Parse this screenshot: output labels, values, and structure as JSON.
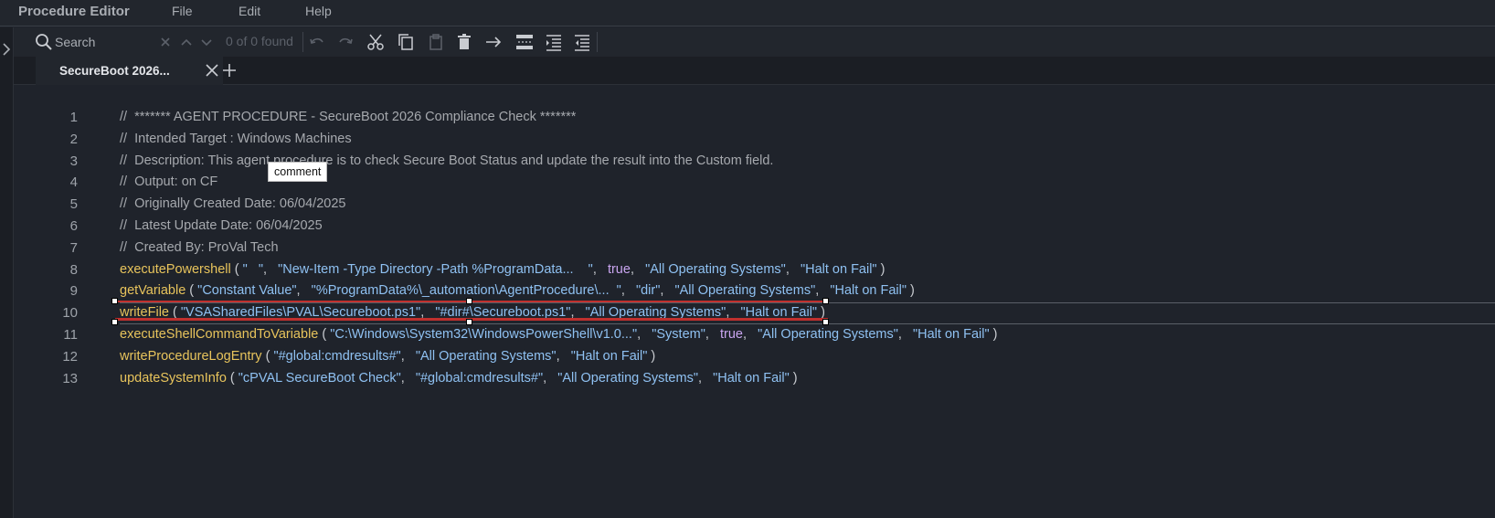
{
  "app": {
    "title": "Procedure Editor"
  },
  "menu": {
    "file": "File",
    "edit": "Edit",
    "help": "Help"
  },
  "toolbar": {
    "search_placeholder": "Search",
    "found_count": "0 of 0 found"
  },
  "tabs": [
    {
      "label": "SecureBoot 2026..."
    }
  ],
  "tooltip": "comment",
  "lines": [
    {
      "num": "1",
      "comment": "//  ******* AGENT PROCEDURE - SecureBoot 2026 Compliance Check *******"
    },
    {
      "num": "2",
      "comment": "//  Intended Target : Windows Machines"
    },
    {
      "num": "3",
      "comment": "//  Description: This agent procedure is to check Secure Boot Status and update the result into the Custom field."
    },
    {
      "num": "4",
      "comment": "//  Output: on CF"
    },
    {
      "num": "5",
      "comment": "//  Originally Created Date: 06/04/2025"
    },
    {
      "num": "6",
      "comment": "//  Latest Update Date: 06/04/2025"
    },
    {
      "num": "7",
      "comment": "//  Created By: ProVal Tech"
    },
    {
      "num": "8",
      "fn": "executePowershell",
      "args": [
        {
          "t": "str",
          "v": "\"   \""
        },
        {
          "t": "str",
          "v": "\"New-Item -Type Directory -Path %ProgramData...    \""
        },
        {
          "t": "bool",
          "v": "true"
        },
        {
          "t": "str",
          "v": "\"All Operating Systems\""
        },
        {
          "t": "str",
          "v": "\"Halt on Fail\""
        }
      ]
    },
    {
      "num": "9",
      "fn": "getVariable",
      "args": [
        {
          "t": "str",
          "v": "\"Constant Value\""
        },
        {
          "t": "str",
          "v": "\"%ProgramData%\\_automation\\AgentProcedure\\...  \""
        },
        {
          "t": "str",
          "v": "\"dir\""
        },
        {
          "t": "str",
          "v": "\"All Operating Systems\""
        },
        {
          "t": "str",
          "v": "\"Halt on Fail\""
        }
      ]
    },
    {
      "num": "10",
      "fn": "writeFile",
      "args": [
        {
          "t": "str",
          "v": "\"VSASharedFiles\\PVAL\\Secureboot.ps1\""
        },
        {
          "t": "str",
          "v": "\"#dir#\\Secureboot.ps1\""
        },
        {
          "t": "str",
          "v": "\"All Operating Systems\""
        },
        {
          "t": "str",
          "v": "\"Halt on Fail\""
        }
      ]
    },
    {
      "num": "11",
      "fn": "executeShellCommandToVariable",
      "args": [
        {
          "t": "str",
          "v": "\"C:\\Windows\\System32\\WindowsPowerShell\\v1.0...\""
        },
        {
          "t": "str",
          "v": "\"System\""
        },
        {
          "t": "bool",
          "v": "true"
        },
        {
          "t": "str",
          "v": "\"All Operating Systems\""
        },
        {
          "t": "str",
          "v": "\"Halt on Fail\""
        }
      ]
    },
    {
      "num": "12",
      "fn": "writeProcedureLogEntry",
      "args": [
        {
          "t": "str",
          "v": "\"#global:cmdresults#\""
        },
        {
          "t": "str",
          "v": "\"All Operating Systems\""
        },
        {
          "t": "str",
          "v": "\"Halt on Fail\""
        }
      ]
    },
    {
      "num": "13",
      "fn": "updateSystemInfo",
      "args": [
        {
          "t": "str",
          "v": "\"cPVAL SecureBoot Check\""
        },
        {
          "t": "str",
          "v": "\"#global:cmdresults#\""
        },
        {
          "t": "str",
          "v": "\"All Operating Systems\""
        },
        {
          "t": "str",
          "v": "\"Halt on Fail\""
        }
      ]
    }
  ]
}
